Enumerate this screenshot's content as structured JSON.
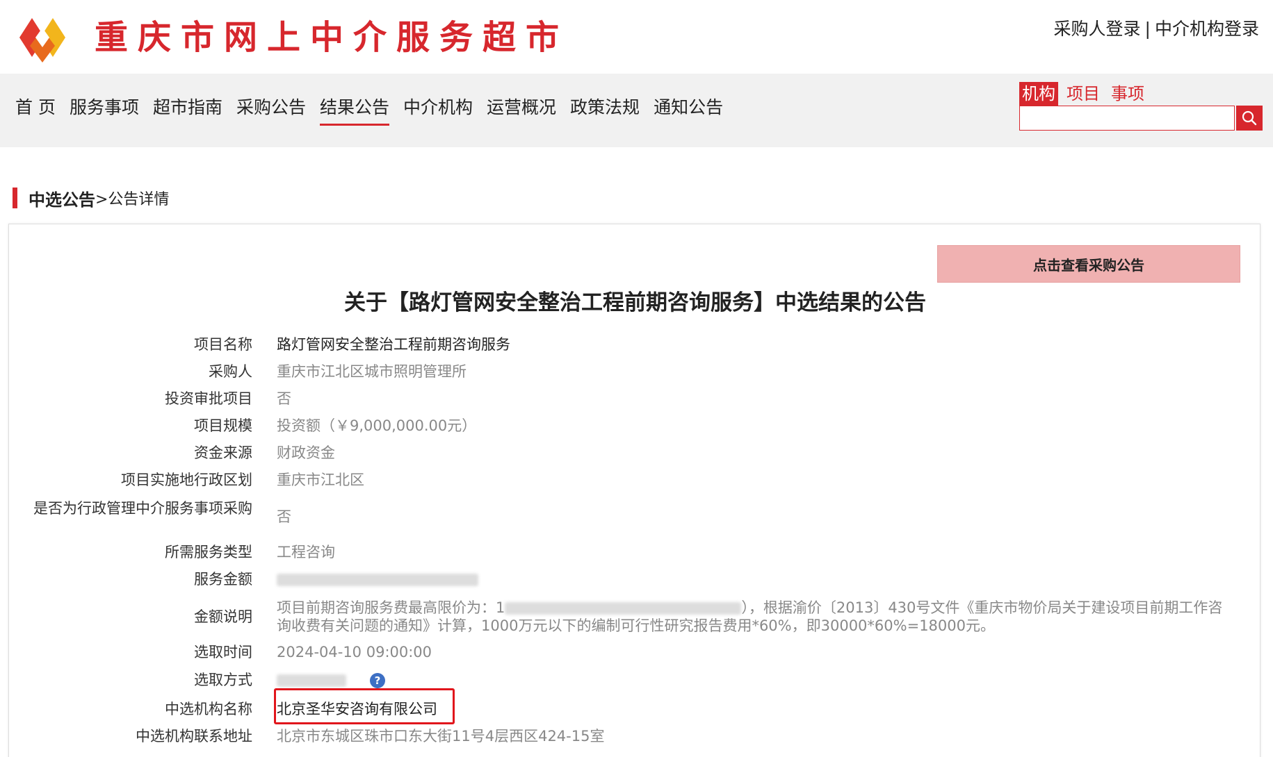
{
  "header": {
    "site_title": "重庆市网上中介服务超市",
    "login_buyer": "采购人登录",
    "separator": "|",
    "login_agency": "中介机构登录"
  },
  "nav": {
    "items": [
      {
        "label": "首 页"
      },
      {
        "label": "服务事项"
      },
      {
        "label": "超市指南"
      },
      {
        "label": "采购公告"
      },
      {
        "label": "结果公告"
      },
      {
        "label": "中介机构"
      },
      {
        "label": "运营概况"
      },
      {
        "label": "政策法规"
      },
      {
        "label": "通知公告"
      }
    ],
    "active": "结果公告"
  },
  "search": {
    "tabs": [
      "机构",
      "项目",
      "事项"
    ],
    "active_tab": "机构",
    "value": ""
  },
  "breadcrumb": {
    "main": "中选公告",
    "sub": ">公告详情"
  },
  "notice": {
    "view_button": "点击查看采购公告",
    "title": "关于【路灯管网安全整治工程前期咨询服务】中选结果的公告",
    "fields": [
      {
        "label": "项目名称",
        "value": "路灯管网安全整治工程前期咨询服务"
      },
      {
        "label": "采购人",
        "value": "重庆市江北区城市照明管理所"
      },
      {
        "label": "投资审批项目",
        "value": "否"
      },
      {
        "label": "项目规模",
        "value": "投资额（￥9,000,000.00元）"
      },
      {
        "label": "资金来源",
        "value": "财政资金"
      },
      {
        "label": "项目实施地行政区划",
        "value": "重庆市江北区"
      },
      {
        "label": "是否为行政管理中介服务事项采购",
        "value": "否"
      },
      {
        "label": "所需服务类型",
        "value": "工程咨询"
      },
      {
        "label": "服务金额",
        "value": ""
      },
      {
        "label": "金额说明",
        "value_prefix": "项目前期咨询服务费最高限价为：1",
        "value_suffix": "），根据渝价〔2013〕430号文件《重庆市物价局关于建设项目前期工作咨询收费有关问题的通知》计算，1000万元以下的编制可行性研究报告费用*60%，即30000*60%=18000元。"
      },
      {
        "label": "选取时间",
        "value": "2024-04-10 09:00:00"
      },
      {
        "label": "选取方式",
        "value": ""
      },
      {
        "label": "中选机构名称",
        "value": "北京圣华安咨询有限公司"
      },
      {
        "label": "中选机构联系地址",
        "value": "北京市东城区珠市口东大街11号4层西区424-15室"
      }
    ]
  },
  "colors": {
    "brand_red": "#d7272d",
    "button_pink": "#f0b1b1",
    "highlight_red": "#e1161c",
    "nav_bg": "#f1f1f1"
  }
}
